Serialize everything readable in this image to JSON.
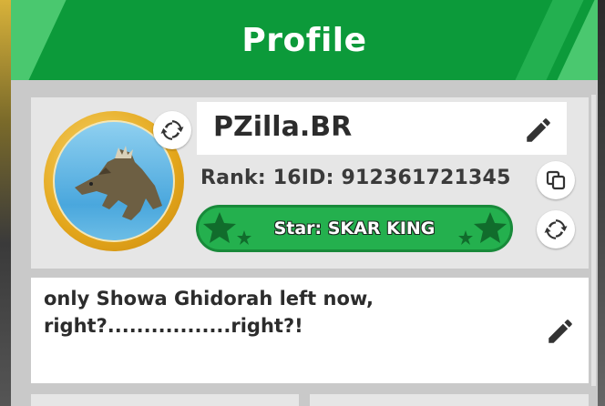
{
  "header": {
    "title": "Profile"
  },
  "profile": {
    "name": "PZilla.BR",
    "rank_label": "Rank:",
    "rank_value": "16",
    "id_label": "ID:",
    "id_value": "912361721345",
    "star_label": "Star: SKAR KING"
  },
  "comment": {
    "line1": "only Showa Ghidorah left now,",
    "line2": "right?.................right?!"
  },
  "colors": {
    "header_green": "#0c9a3a",
    "star_green": "#24b04e",
    "ring_gold": "#e3a61b"
  },
  "icons": [
    "refresh-icon",
    "pencil-icon",
    "copy-icon",
    "star-icon"
  ]
}
